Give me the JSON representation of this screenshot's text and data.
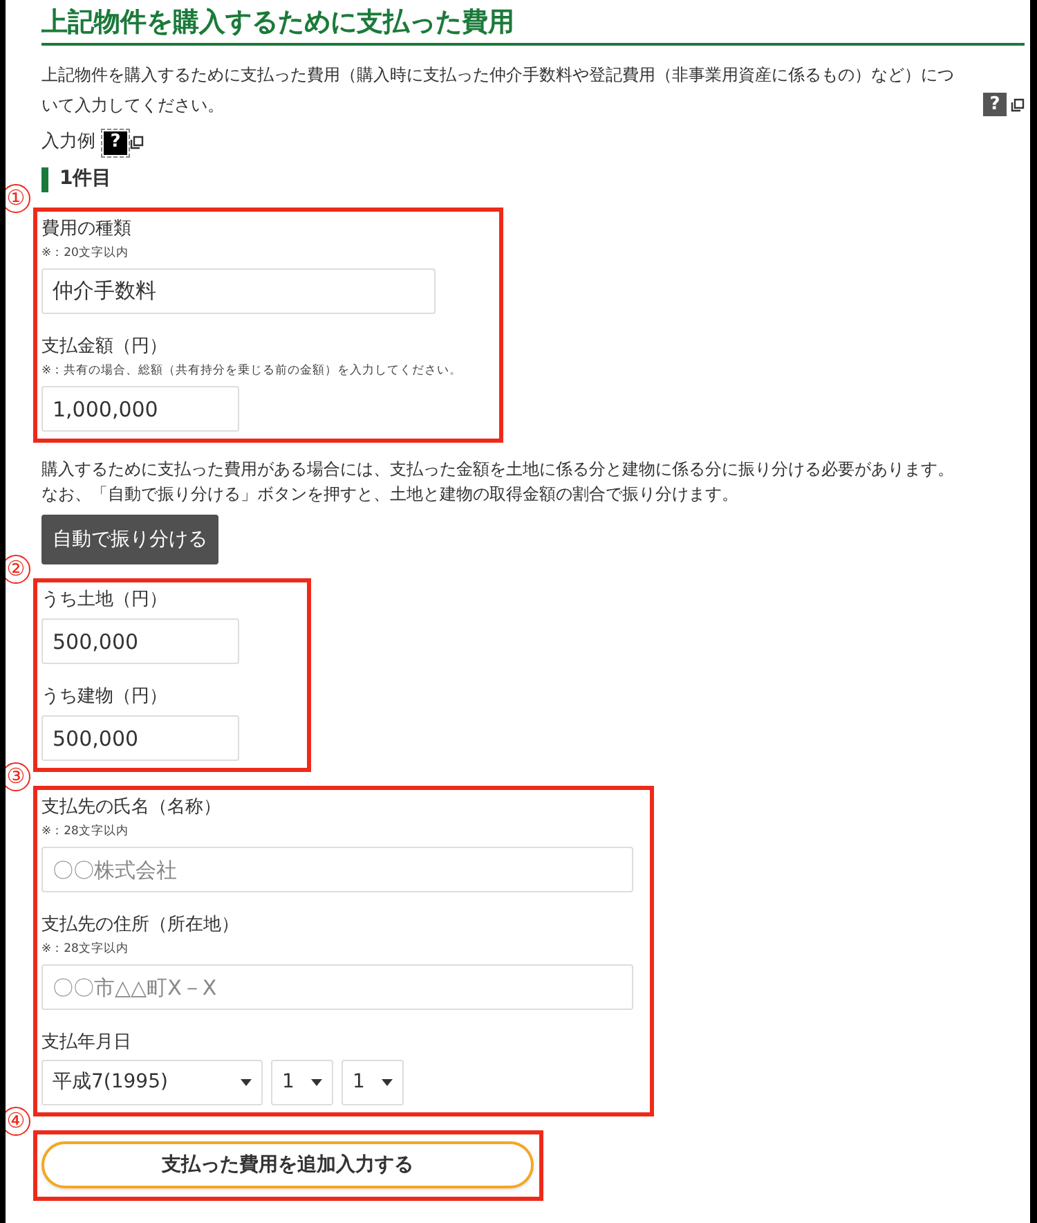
{
  "title": "上記物件を購入するために支払った費用",
  "description": "上記物件を購入するために支払った費用（購入時に支払った仲介手数料や登記費用（非事業用資産に係るもの）など）について入力してください。",
  "description_help": {
    "mark": "?",
    "focused": false
  },
  "example_label": "入力例",
  "example_help": {
    "mark": "?",
    "focused": true
  },
  "item_heading": "1件目",
  "sections": [
    {
      "kind": "group",
      "marker": "①",
      "fields": [
        {
          "kind": "type",
          "label": "費用の種類",
          "note": "※：20文字以内",
          "value": "仲介手数料"
        },
        {
          "kind": "amount",
          "label": "支払金額（円）",
          "note": "※：共有の場合、総額（共有持分を乗じる前の金額）を入力してください。",
          "value": "1,000,000"
        }
      ]
    },
    {
      "kind": "notice",
      "lines": [
        "購入するために支払った費用がある場合には、支払った金額を土地に係る分と建物に係る分に振り分ける必要があります。",
        "なお、「自動で振り分ける」ボタンを押すと、土地と建物の取得金額の割合で振り分けます。"
      ]
    },
    {
      "kind": "action",
      "label": "自動で振り分ける"
    },
    {
      "kind": "group",
      "marker": "②",
      "fields": [
        {
          "kind": "amount",
          "label": "うち土地（円）",
          "value": "500,000"
        },
        {
          "kind": "amount",
          "label": "うち建物（円）",
          "value": "500,000"
        }
      ]
    },
    {
      "kind": "group",
      "marker": "③",
      "fields": [
        {
          "kind": "party",
          "label": "支払先の氏名（名称）",
          "note": "※：28文字以内",
          "placeholder": "〇〇株式会社"
        },
        {
          "kind": "party",
          "label": "支払先の住所（所在地）",
          "note": "※：28文字以内",
          "placeholder": "〇〇市△△町X－X"
        },
        {
          "kind": "date",
          "label": "支払年月日",
          "selects": [
            "平成7(1995)",
            "1",
            "1"
          ]
        }
      ]
    },
    {
      "kind": "group",
      "marker": "④",
      "fields": [
        {
          "kind": "add-button",
          "label": "支払った費用を追加入力する"
        }
      ]
    }
  ]
}
